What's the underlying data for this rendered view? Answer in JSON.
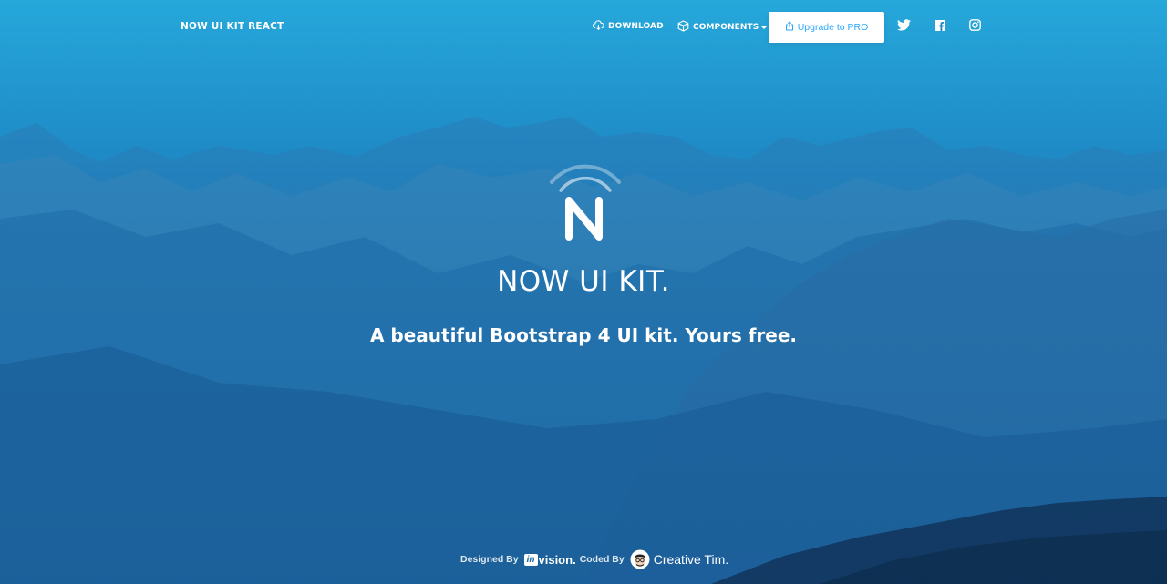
{
  "navbar": {
    "brand": "NOW UI KIT REACT",
    "download_label": "DOWNLOAD",
    "components_label": "COMPONENTS",
    "upgrade_label": "Upgrade to PRO"
  },
  "hero": {
    "title": "NOW UI KIT.",
    "subtitle": "A beautiful Bootstrap 4 UI kit. Yours free."
  },
  "credits": {
    "designed_by": "Designed By",
    "invision_in": "in",
    "invision_text": "vision.",
    "coded_by": "Coded By",
    "author": "Creative Tim."
  },
  "icons": {
    "download": "cloud-download-icon",
    "components": "box-icon",
    "upgrade": "share-icon",
    "twitter": "twitter-icon",
    "facebook": "facebook-icon",
    "instagram": "instagram-icon",
    "logo": "now-ui-logo"
  },
  "colors": {
    "accent": "#2ca8ff",
    "background_top": "#25a8d7",
    "background_bottom": "#164d85"
  }
}
